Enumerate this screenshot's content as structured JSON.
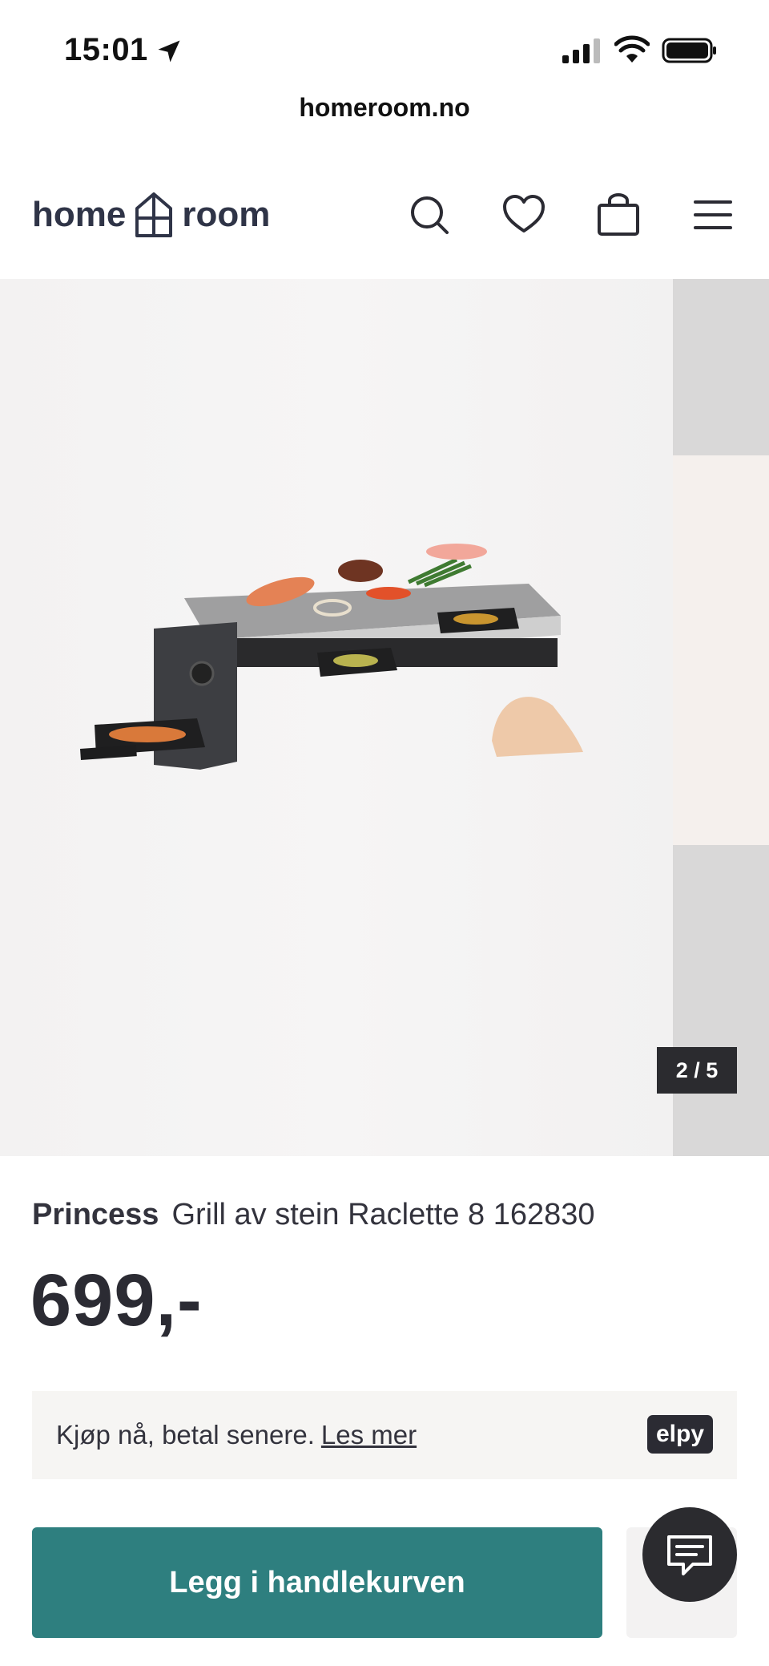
{
  "status_bar": {
    "time": "15:01"
  },
  "browser": {
    "url": "homeroom.no"
  },
  "header": {
    "logo_left": "home",
    "logo_right": "room",
    "icons": [
      "search-icon",
      "heart-icon",
      "shopping-bag-icon",
      "menu-icon"
    ]
  },
  "gallery": {
    "counter": "2 / 5"
  },
  "product": {
    "brand": "Princess",
    "name": "Grill av stein Raclette 8 162830",
    "price": "699,-"
  },
  "pay_later": {
    "text": "Kjøp nå, betal senere.",
    "link": "Les mer",
    "badge": "elpy"
  },
  "actions": {
    "add_to_cart": "Legg i handlekurven"
  },
  "colors": {
    "accent": "#2e7f7f",
    "dark": "#2b2b2f"
  }
}
